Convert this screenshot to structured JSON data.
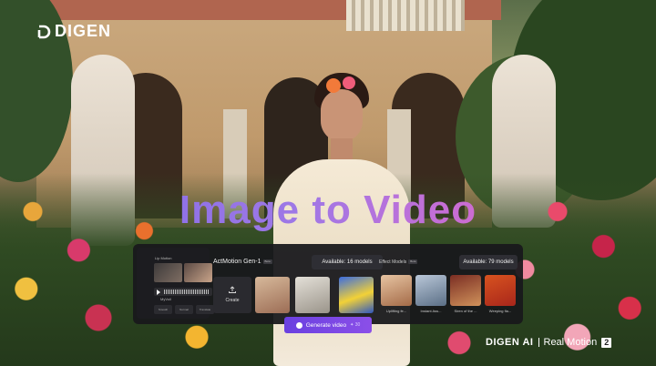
{
  "brand": {
    "logo_text": "DIGEN"
  },
  "headline": "Image to Video",
  "lip_motion": {
    "title": "Lip Motion",
    "audio_label": "MyVoil",
    "buttons": [
      "Smooth",
      "Normal",
      "Translate"
    ]
  },
  "model": {
    "name": "ActMotion Gen-1",
    "badge": "Beta",
    "available": "Available: 16 models",
    "create_label": "Create"
  },
  "effects": {
    "label": "Effect Models",
    "badge": "Beta",
    "available": "Available: 79 models",
    "items": [
      "Uplifting fe...",
      "Instant Ass...",
      "Siren of the ...",
      "Weeping fla..."
    ]
  },
  "generate": {
    "label": "Generate video",
    "cost": "✦ 30"
  },
  "watermark": {
    "brand": "DIGEN AI",
    "product": "Real Motion",
    "version": "2"
  },
  "icons": [
    "digen-logo-icon",
    "play-icon",
    "upload-icon",
    "generate-icon"
  ]
}
